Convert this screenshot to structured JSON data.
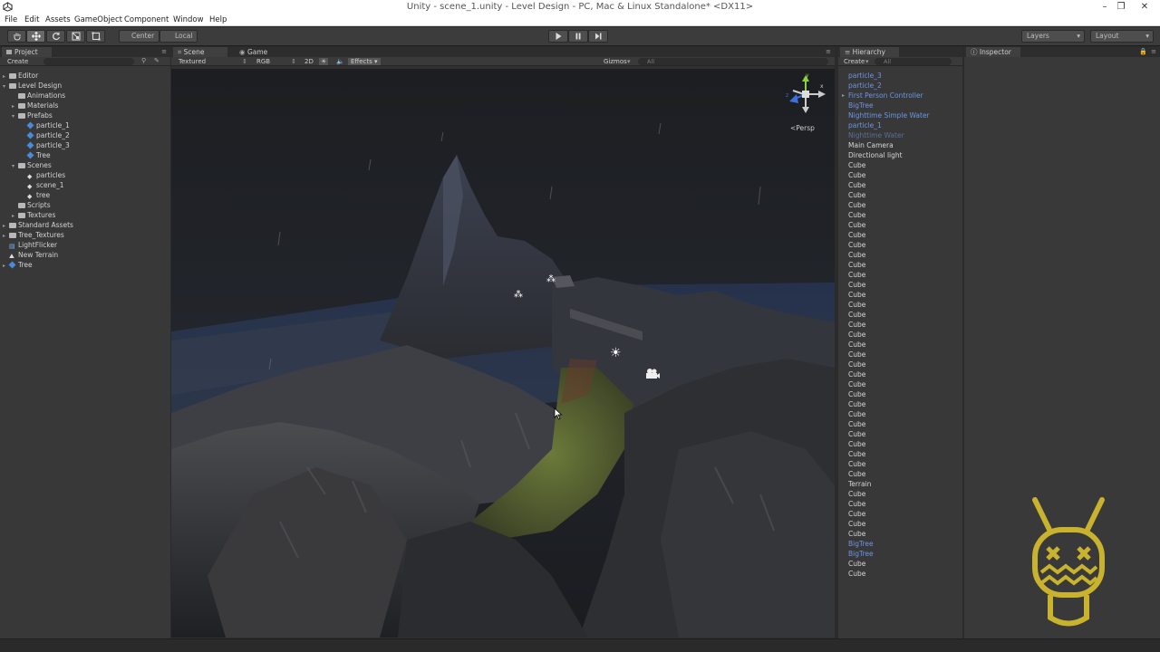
{
  "window": {
    "title": "Unity - scene_1.unity - Level Design - PC, Mac & Linux Standalone* <DX11>",
    "minimize": "–",
    "maximize": "❐",
    "close": "✕"
  },
  "menu": [
    "File",
    "Edit",
    "Assets",
    "GameObject",
    "Component",
    "Window",
    "Help"
  ],
  "toolbar": {
    "pivot": "Center",
    "space": "Local",
    "layers": "Layers",
    "layout": "Layout"
  },
  "project": {
    "tab": "Project",
    "create": "Create",
    "items": [
      {
        "label": "Editor",
        "kind": "folder",
        "depth": 0,
        "arrow": "▸"
      },
      {
        "label": "Level Design",
        "kind": "folder",
        "depth": 0,
        "arrow": "▾"
      },
      {
        "label": "Animations",
        "kind": "folder",
        "depth": 1,
        "arrow": ""
      },
      {
        "label": "Materials",
        "kind": "folder",
        "depth": 1,
        "arrow": "▸"
      },
      {
        "label": "Prefabs",
        "kind": "folder",
        "depth": 1,
        "arrow": "▾"
      },
      {
        "label": "particle_1",
        "kind": "prefab",
        "depth": 2,
        "arrow": ""
      },
      {
        "label": "particle_2",
        "kind": "prefab",
        "depth": 2,
        "arrow": ""
      },
      {
        "label": "particle_3",
        "kind": "prefab",
        "depth": 2,
        "arrow": ""
      },
      {
        "label": "Tree",
        "kind": "prefab",
        "depth": 2,
        "arrow": ""
      },
      {
        "label": "Scenes",
        "kind": "folder",
        "depth": 1,
        "arrow": "▾"
      },
      {
        "label": "particles",
        "kind": "scene",
        "depth": 2,
        "arrow": ""
      },
      {
        "label": "scene_1",
        "kind": "scene",
        "depth": 2,
        "arrow": ""
      },
      {
        "label": "tree",
        "kind": "scene",
        "depth": 2,
        "arrow": ""
      },
      {
        "label": "Scripts",
        "kind": "folder",
        "depth": 1,
        "arrow": ""
      },
      {
        "label": "Textures",
        "kind": "folder",
        "depth": 1,
        "arrow": "▸"
      },
      {
        "label": "Standard Assets",
        "kind": "folder",
        "depth": 0,
        "arrow": "▸"
      },
      {
        "label": "Tree_Textures",
        "kind": "folder",
        "depth": 0,
        "arrow": "▸"
      },
      {
        "label": "LightFlicker",
        "kind": "script",
        "depth": 0,
        "arrow": ""
      },
      {
        "label": "New Terrain",
        "kind": "terrain",
        "depth": 0,
        "arrow": ""
      },
      {
        "label": "Tree",
        "kind": "prefab",
        "depth": 0,
        "arrow": "▸"
      }
    ]
  },
  "scene": {
    "tab_scene": "Scene",
    "tab_game": "Game",
    "shading": "Textured",
    "render_mode": "RGB",
    "mode_2d": "2D",
    "effects": "Effects",
    "gizmos": "Gizmos",
    "search": "All",
    "persp": "Persp",
    "gizmo_y": "y",
    "gizmo_x": "x",
    "gizmo_z": "z"
  },
  "hierarchy": {
    "tab": "Hierarchy",
    "create": "Create",
    "search": "All",
    "items": [
      {
        "label": "particle_3",
        "type": "prefab"
      },
      {
        "label": "particle_2",
        "type": "prefab"
      },
      {
        "label": "First Person Controller",
        "type": "prefab",
        "arrow": "▸"
      },
      {
        "label": "BigTree",
        "type": "prefab"
      },
      {
        "label": "Nighttime Simple Water",
        "type": "prefab"
      },
      {
        "label": "particle_1",
        "type": "prefab"
      },
      {
        "label": "Nighttime Water",
        "type": "prefab-dim"
      },
      {
        "label": "Main Camera",
        "type": "normal"
      },
      {
        "label": "Directional light",
        "type": "normal"
      },
      {
        "label": "Cube",
        "type": "normal"
      },
      {
        "label": "Cube",
        "type": "normal"
      },
      {
        "label": "Cube",
        "type": "normal"
      },
      {
        "label": "Cube",
        "type": "normal"
      },
      {
        "label": "Cube",
        "type": "normal"
      },
      {
        "label": "Cube",
        "type": "normal"
      },
      {
        "label": "Cube",
        "type": "normal"
      },
      {
        "label": "Cube",
        "type": "normal"
      },
      {
        "label": "Cube",
        "type": "normal"
      },
      {
        "label": "Cube",
        "type": "normal"
      },
      {
        "label": "Cube",
        "type": "normal"
      },
      {
        "label": "Cube",
        "type": "normal"
      },
      {
        "label": "Cube",
        "type": "normal"
      },
      {
        "label": "Cube",
        "type": "normal"
      },
      {
        "label": "Cube",
        "type": "normal"
      },
      {
        "label": "Cube",
        "type": "normal"
      },
      {
        "label": "Cube",
        "type": "normal"
      },
      {
        "label": "Cube",
        "type": "normal"
      },
      {
        "label": "Cube",
        "type": "normal"
      },
      {
        "label": "Cube",
        "type": "normal"
      },
      {
        "label": "Cube",
        "type": "normal"
      },
      {
        "label": "Cube",
        "type": "normal"
      },
      {
        "label": "Cube",
        "type": "normal"
      },
      {
        "label": "Cube",
        "type": "normal"
      },
      {
        "label": "Cube",
        "type": "normal"
      },
      {
        "label": "Cube",
        "type": "normal"
      },
      {
        "label": "Cube",
        "type": "normal"
      },
      {
        "label": "Cube",
        "type": "normal"
      },
      {
        "label": "Cube",
        "type": "normal"
      },
      {
        "label": "Cube",
        "type": "normal"
      },
      {
        "label": "Cube",
        "type": "normal"
      },
      {
        "label": "Cube",
        "type": "normal"
      },
      {
        "label": "Terrain",
        "type": "normal"
      },
      {
        "label": "Cube",
        "type": "normal"
      },
      {
        "label": "Cube",
        "type": "normal"
      },
      {
        "label": "Cube",
        "type": "normal"
      },
      {
        "label": "Cube",
        "type": "normal"
      },
      {
        "label": "Cube",
        "type": "normal"
      },
      {
        "label": "BigTree",
        "type": "prefab"
      },
      {
        "label": "BigTree",
        "type": "prefab"
      },
      {
        "label": "Cube",
        "type": "normal"
      },
      {
        "label": "Cube",
        "type": "normal"
      }
    ]
  },
  "inspector": {
    "tab": "Inspector"
  },
  "colors": {
    "prefab_text": "#6c95e6",
    "mascot": "#c8b22e"
  }
}
